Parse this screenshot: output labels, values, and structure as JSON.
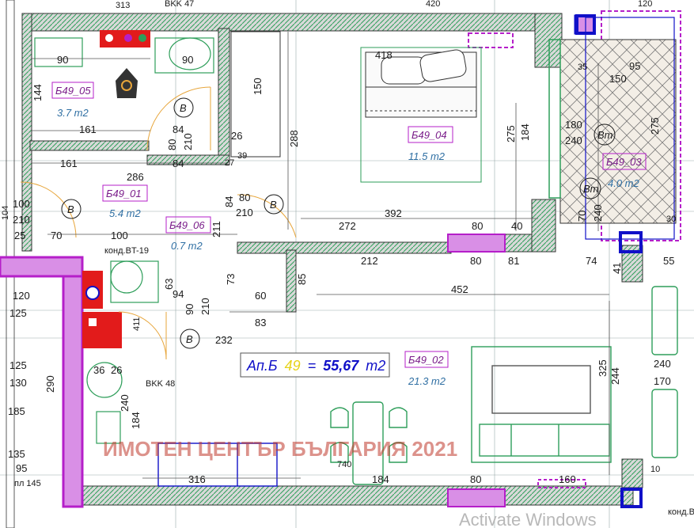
{
  "rooms": [
    {
      "id": "Б49_05",
      "area": "3.7 m2"
    },
    {
      "id": "Б49_04",
      "area": "11.5 m2"
    },
    {
      "id": "Б49_03",
      "area": "4.0 m2"
    },
    {
      "id": "Б49_01",
      "area": "5.4 m2"
    },
    {
      "id": "Б49_06",
      "area": "0.7 m2"
    },
    {
      "id": "Б49_02",
      "area": "21.3 m2"
    }
  ],
  "summary": {
    "prefix": "Ап.Б",
    "number": "49",
    "eq": "=",
    "value": "55,67",
    "unit": "m2"
  },
  "doors": [
    "B",
    "B",
    "B",
    "B",
    "Bт",
    "Bт"
  ],
  "door_sizes": [
    "80",
    "210",
    "100",
    "210",
    "80",
    "210",
    "90",
    "210",
    "180",
    "240",
    "70",
    "240"
  ],
  "dimensions": {
    "top": [
      "313",
      "BKK 47",
      "420",
      "120"
    ],
    "row1": [
      "90",
      "90",
      "418",
      "35",
      "95",
      "150"
    ],
    "row2": [
      "144",
      "161",
      "84",
      "26",
      "184",
      "275",
      "288",
      "275",
      "150"
    ],
    "row3": [
      "161",
      "84",
      "27",
      "39",
      "286",
      "211",
      "84"
    ],
    "row4": [
      "392",
      "272",
      "80",
      "40",
      "30",
      "70",
      "25",
      "100",
      "104"
    ],
    "row5": [
      "212",
      "80",
      "81",
      "74",
      "55",
      "63",
      "73",
      "85",
      "41"
    ],
    "row6": [
      "452",
      "120",
      "125",
      "60",
      "94",
      "83",
      "232",
      "411"
    ],
    "row7": [
      "36",
      "26",
      "125",
      "130",
      "185",
      "290",
      "240",
      "184",
      "325",
      "244",
      "240",
      "170"
    ],
    "row8": [
      "135",
      "95",
      "316",
      "740",
      "184",
      "80",
      "160",
      "10"
    ],
    "labels": [
      "конд.BT-19",
      "BKK 48",
      "пл 145",
      "конд.ВТ"
    ]
  },
  "watermark": "ИМОТЕН ЦЕНТЪР БЪЛГАРИЯ 2021",
  "os_watermark": "Activate Windows",
  "colors": {
    "wall": "#3c3c3c",
    "hatch": "#2e9e5a",
    "purple": "#b51fc9",
    "red": "#e21b1b",
    "blue": "#1010c8",
    "teal": "#1f9e87"
  }
}
